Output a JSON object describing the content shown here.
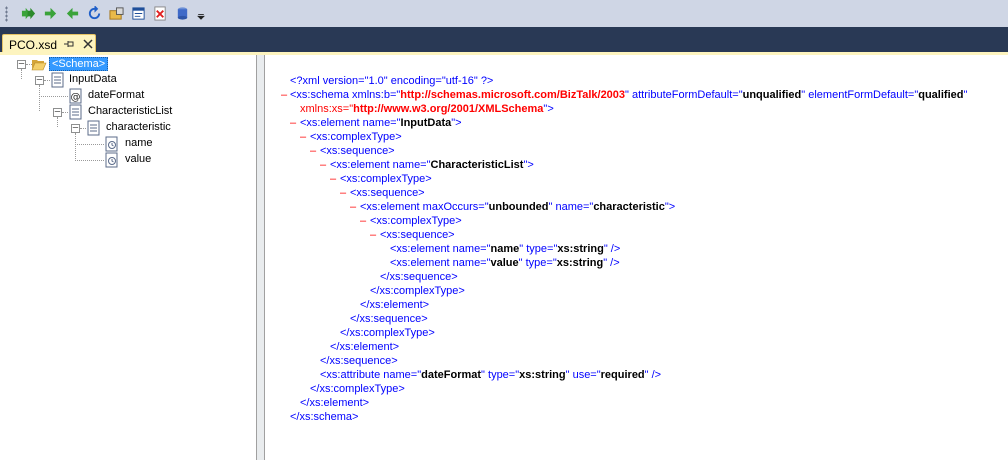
{
  "toolbar": {
    "buttons": [
      {
        "name": "validate-all-icon"
      },
      {
        "name": "forward-arrow-icon"
      },
      {
        "name": "back-arrow-icon"
      },
      {
        "name": "refresh-icon"
      },
      {
        "name": "folder-lock-icon"
      },
      {
        "name": "properties-icon"
      },
      {
        "name": "delete-icon"
      },
      {
        "name": "database-icon"
      },
      {
        "name": "overflow-dropdown-icon"
      }
    ]
  },
  "tab": {
    "title": "PCO.xsd"
  },
  "tree": {
    "root": "<Schema>",
    "input_data": "InputData",
    "date_format": "dateFormat",
    "characteristic_list": "CharacteristicList",
    "characteristic": "characteristic",
    "name": "name",
    "value": "value"
  },
  "xml": {
    "l1": {
      "a": "<?xml version=\"1.0\" encoding=\"utf-16\" ?>"
    },
    "l2": {
      "a": "<xs:schema xmlns:b=\"",
      "b": "http://schemas.microsoft.com/BizTalk/2003",
      "c": "\" attributeFormDefault=\"",
      "d": "unqualified",
      "e": "\" elementFormDefault=\"",
      "f": "qualified",
      "g": "\""
    },
    "l3": {
      "a": "xmlns:xs=\"",
      "b": "http://www.w3.org/2001/XMLSchema",
      "c": "\">"
    },
    "l4": {
      "a": "<xs:element name=\"",
      "b": "InputData",
      "c": "\">"
    },
    "l5": {
      "a": "<xs:complexType>"
    },
    "l6": {
      "a": "<xs:sequence>"
    },
    "l7": {
      "a": "<xs:element name=\"",
      "b": "CharacteristicList",
      "c": "\">"
    },
    "l8": {
      "a": "<xs:complexType>"
    },
    "l9": {
      "a": "<xs:sequence>"
    },
    "l10": {
      "a": "<xs:element maxOccurs=\"",
      "b": "unbounded",
      "c": "\" name=\"",
      "d": "characteristic",
      "e": "\">"
    },
    "l11": {
      "a": "<xs:complexType>"
    },
    "l12": {
      "a": "<xs:sequence>"
    },
    "l13": {
      "a": "<xs:element name=\"",
      "b": "name",
      "c": "\" type=\"",
      "d": "xs:string",
      "e": "\" />"
    },
    "l14": {
      "a": "<xs:element name=\"",
      "b": "value",
      "c": "\" type=\"",
      "d": "xs:string",
      "e": "\" />"
    },
    "l15": {
      "a": "</xs:sequence>"
    },
    "l16": {
      "a": "</xs:complexType>"
    },
    "l17": {
      "a": "</xs:element>"
    },
    "l18": {
      "a": "</xs:sequence>"
    },
    "l19": {
      "a": "</xs:complexType>"
    },
    "l20": {
      "a": "</xs:element>"
    },
    "l21": {
      "a": "</xs:sequence>"
    },
    "l22": {
      "a": "<xs:attribute name=\"",
      "b": "dateFormat",
      "c": "\" type=\"",
      "d": "xs:string",
      "e": "\" use=\"",
      "f": "required",
      "g": "\" />"
    },
    "l23": {
      "a": "</xs:complexType>"
    },
    "l24": {
      "a": "</xs:element>"
    },
    "l25": {
      "a": "</xs:schema>"
    },
    "collapse_glyph": "–"
  }
}
